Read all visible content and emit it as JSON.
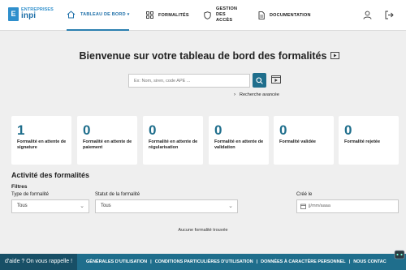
{
  "brand": {
    "logo_letter": "E",
    "line1": "ENTREPRISES",
    "line2": "inpi"
  },
  "nav": {
    "dashboard": "TABLEAU DE BORD",
    "formalities": "FORMALITÉS",
    "gestion_line1": "GESTION",
    "gestion_line2": "DES",
    "gestion_line3": "ACCÈS",
    "documentation": "DOCUMENTATION"
  },
  "page": {
    "title": "Bienvenue sur votre tableau de bord des formalités"
  },
  "search": {
    "placeholder": "Ex: Nom, siren, code APE ...",
    "advanced_label": "Recherche avancée"
  },
  "cards": [
    {
      "count": "1",
      "label": "Formalité en attente de signature"
    },
    {
      "count": "0",
      "label": "Formalité en attente de paiement"
    },
    {
      "count": "0",
      "label": "Formalité en attente de régularisation"
    },
    {
      "count": "0",
      "label": "Formalité en attente de validation"
    },
    {
      "count": "0",
      "label": "Formalité validée"
    },
    {
      "count": "0",
      "label": "Formalité rejetée"
    }
  ],
  "activity": {
    "title": "Activité des formalités",
    "filters_title": "Filtres",
    "type_label": "Type de formalité",
    "type_value": "Tous",
    "status_label": "Statut de la formalité",
    "status_value": "Tous",
    "created_label": "Créé le",
    "created_placeholder": "jj/mm/aaaa",
    "empty_message": "Aucune formalité trouvée"
  },
  "footer": {
    "callback": "d'aide ? On vous rappelle !",
    "links": [
      "GÉNÉRALES D'UTILISATION",
      "CONDITIONS PARTICULIÈRES D'UTILISATION",
      "DONNÉES À CARACTÈRE PERSONNEL",
      "NOUS CONTAC"
    ]
  },
  "colors": {
    "accent": "#1f6e8c",
    "brand_blue": "#2f8fcc",
    "background": "#efefef",
    "footer": "#1f6e8c"
  }
}
